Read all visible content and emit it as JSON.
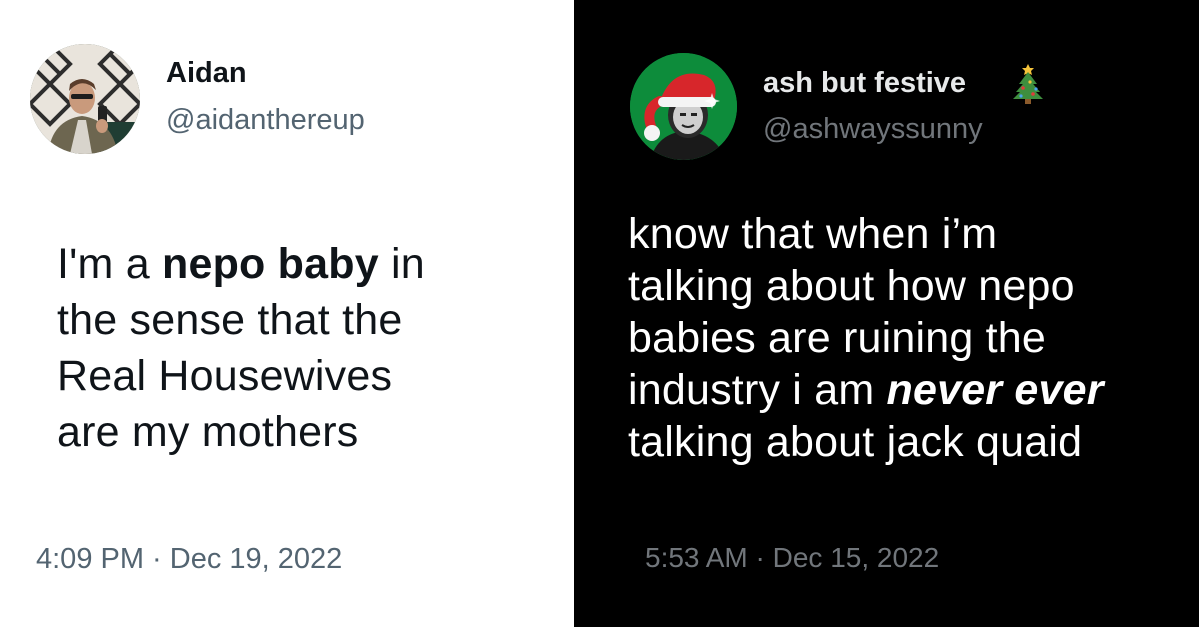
{
  "left_tweet": {
    "display_name": "Aidan",
    "handle": "@aidanthereup",
    "text": {
      "l1_pre": "I'm a ",
      "l1_bold": "nepo baby",
      "l1_post": " in",
      "l2": "the sense that the",
      "l3": "Real Housewives",
      "l4": "are my mothers"
    },
    "time": "4:09 PM",
    "separator": " · ",
    "date": "Dec 19, 2022",
    "avatar_icon": "profile-photo",
    "theme": "light"
  },
  "right_tweet": {
    "display_name": "ash but festive",
    "name_emoji": "christmas-tree-icon",
    "handle": "@ashwayssunny",
    "text": {
      "l1": "know that when i’m",
      "l2": "talking about how nepo",
      "l3": "babies are ruining the",
      "l4_pre": "industry i am ",
      "l4_bold_italic": "never ever",
      "l5": "talking about jack quaid"
    },
    "time": "5:53 AM",
    "separator": " · ",
    "date": "Dec 15, 2022",
    "avatar_icon": "profile-photo-santa-hat",
    "theme": "dark"
  },
  "colors": {
    "light_bg": "#ffffff",
    "dark_bg": "#000000",
    "light_text": "#0f1419",
    "light_muted": "#536471",
    "dark_text": "#e7e9ea",
    "dark_muted": "#71767b"
  }
}
